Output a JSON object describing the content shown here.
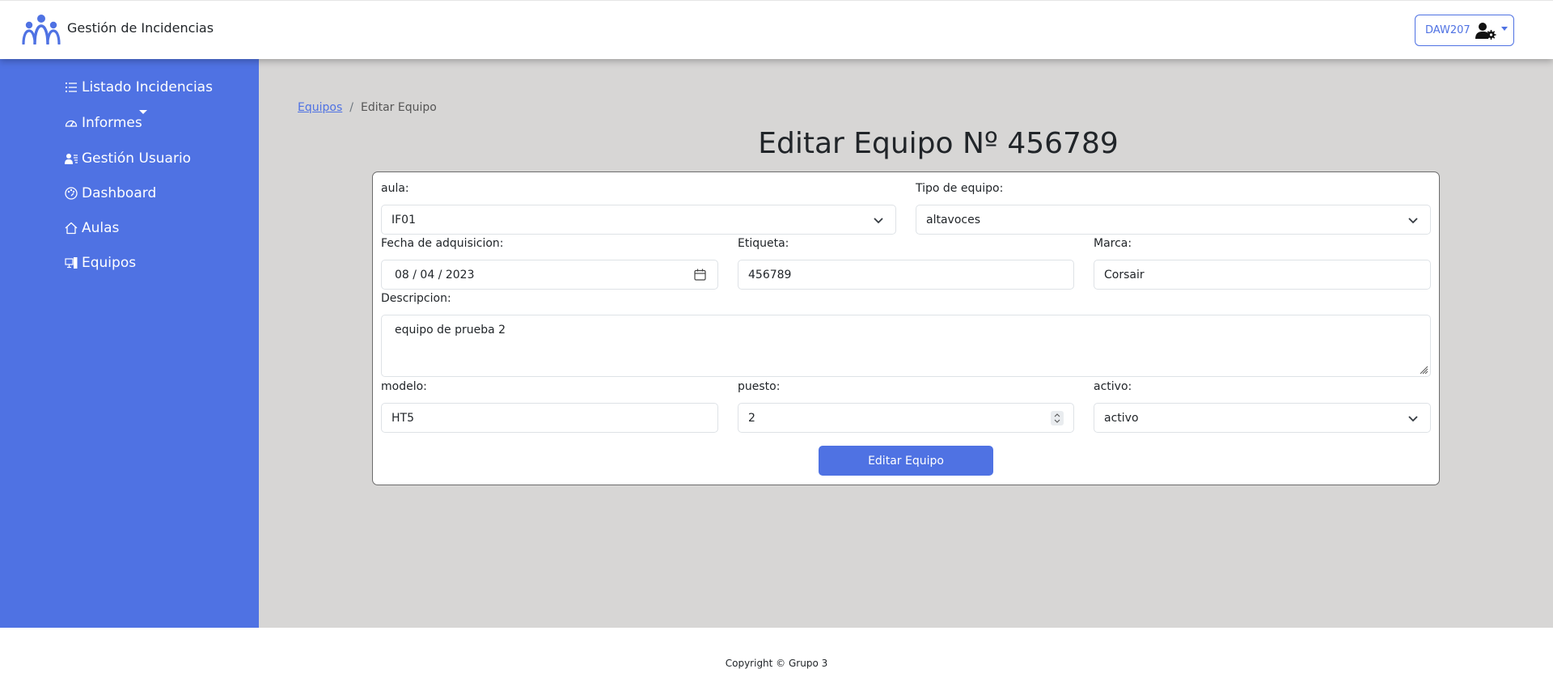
{
  "header": {
    "app_title": "Gestión de Incidencias",
    "user_label": "DAW207",
    "logo_icon": "people-group-icon",
    "user_icon": "user-gear-icon"
  },
  "sidebar": {
    "items": [
      {
        "label": "Listado Incidencias",
        "icon": "list-icon"
      },
      {
        "label": "Informes",
        "icon": "gauge-icon",
        "has_dropdown": true
      },
      {
        "label": "Gestión Usuario",
        "icon": "user-lines-icon"
      },
      {
        "label": "Dashboard",
        "icon": "palette-icon"
      },
      {
        "label": "Aulas",
        "icon": "house-icon"
      },
      {
        "label": "Equipos",
        "icon": "computer-icon"
      }
    ]
  },
  "breadcrumb": {
    "parent": "Equipos",
    "separator": "/",
    "current": "Editar Equipo"
  },
  "page_title": "Editar Equipo Nº 456789",
  "form": {
    "aula": {
      "label": "aula:",
      "value": "IF01"
    },
    "tipo": {
      "label": "Tipo de equipo:",
      "value": "altavoces"
    },
    "fecha": {
      "label": "Fecha de adquisicion:",
      "value": "08 / 04 / 2023"
    },
    "etiqueta": {
      "label": "Etiqueta:",
      "value": "456789"
    },
    "marca": {
      "label": "Marca:",
      "value": "Corsair"
    },
    "descripcion": {
      "label": "Descripcion:",
      "value": "equipo de prueba 2"
    },
    "modelo": {
      "label": "modelo:",
      "value": "HT5"
    },
    "puesto": {
      "label": "puesto:",
      "value": "2"
    },
    "activo": {
      "label": "activo:",
      "value": "activo"
    },
    "submit_label": "Editar Equipo"
  },
  "footer": {
    "text": "Copyright © Grupo 3"
  },
  "colors": {
    "accent": "#4f72e3",
    "main_bg": "#d7d6d5",
    "header_bg": "#ffffff"
  }
}
